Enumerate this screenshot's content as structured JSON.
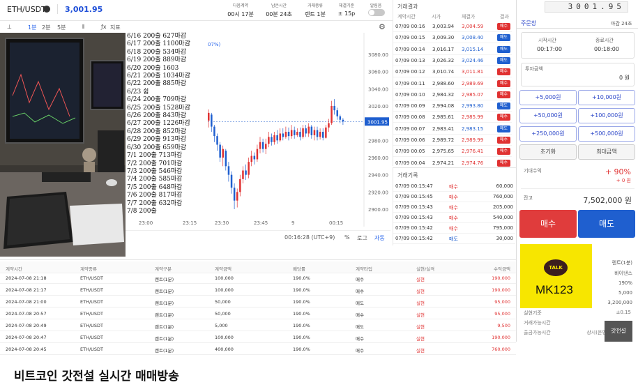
{
  "header": {
    "pair": "ETH/USDT",
    "price": "3,001.95",
    "cols": [
      {
        "label": "다음계약",
        "value": "00시 17분"
      },
      {
        "label": "남은시간",
        "value": "00분 24초"
      },
      {
        "label": "거래종류",
        "value": "렌트 1분"
      },
      {
        "label": "체결기준",
        "value": "± 15p"
      },
      {
        "label": "알림음",
        "value": ""
      }
    ]
  },
  "toolbar": {
    "items": [
      "1분",
      "2분",
      "5분",
      "지표"
    ]
  },
  "chart_data": {
    "type": "candlestick",
    "y_ticks": [
      "3080.00",
      "3060.00",
      "3040.00",
      "3020.00",
      "3001.95",
      "2980.00",
      "2960.00",
      "2940.00",
      "2920.00",
      "2900.00"
    ],
    "x_ticks": [
      "23:00",
      "23:15",
      "23:30",
      "23:45",
      "9",
      "00:15"
    ],
    "current_price": "3001.95",
    "pct_label": "07%)"
  },
  "chart_footer": {
    "time": "00:16:28 (UTC+9)",
    "pct": "%",
    "log": "로그",
    "auto": "자동"
  },
  "notes": [
    "6/16 200출 627마감",
    "6/17 200출 1100마감",
    "6/18 200출 534마감",
    "6/19 200출 889마감",
    "6/20 200출 1603",
    "6/21 200출 1034마감",
    "6/22 200출 885마감",
    "6/23 쉼",
    "6/24 200출 709마감",
    "6/25 200출 1528마감",
    "6/26 200출 843마감",
    "6/27 200출 1226마감",
    "6/28 200출 852마감",
    "6/29 200출 913마감",
    "6/30 200출 659마감",
    "7/1  200출 713마감",
    "7/2  200출 701마감",
    "7/3  200출 546마감",
    "7/4  200출 585마감",
    "7/5  200출 648마감",
    "7/6  200출 817마감",
    "7/7  200출 632마감",
    "7/8  200출"
  ],
  "orderbook": {
    "title": "거래결과",
    "headers": [
      "계약시간",
      "시가",
      "체결가",
      "결과"
    ],
    "rows": [
      {
        "time": "07/09 00:16",
        "open": "3,003.94",
        "close": "3,004.59",
        "result": "매수",
        "color": "red"
      },
      {
        "time": "07/09 00:15",
        "open": "3,009.30",
        "close": "3,008.40",
        "result": "매도",
        "color": "blue"
      },
      {
        "time": "07/09 00:14",
        "open": "3,016.17",
        "close": "3,015.14",
        "result": "매도",
        "color": "blue"
      },
      {
        "time": "07/09 00:13",
        "open": "3,026.32",
        "close": "3,024.46",
        "result": "매도",
        "color": "blue"
      },
      {
        "time": "07/09 00:12",
        "open": "3,010.74",
        "close": "3,011.81",
        "result": "매수",
        "color": "red"
      },
      {
        "time": "07/09 00:11",
        "open": "2,988.60",
        "close": "2,989.69",
        "result": "매수",
        "color": "red"
      },
      {
        "time": "07/09 00:10",
        "open": "2,984.32",
        "close": "2,985.07",
        "result": "매수",
        "color": "red"
      },
      {
        "time": "07/09 00:09",
        "open": "2,994.08",
        "close": "2,993.80",
        "result": "매도",
        "color": "blue"
      },
      {
        "time": "07/09 00:08",
        "open": "2,985.61",
        "close": "2,985.99",
        "result": "매수",
        "color": "red"
      },
      {
        "time": "07/09 00:07",
        "open": "2,983.41",
        "close": "2,983.15",
        "result": "매도",
        "color": "blue"
      },
      {
        "time": "07/09 00:06",
        "open": "2,989.72",
        "close": "2,989.99",
        "result": "매수",
        "color": "red"
      },
      {
        "time": "07/09 00:05",
        "open": "2,975.65",
        "close": "2,976.41",
        "result": "매수",
        "color": "red"
      },
      {
        "time": "07/09 00:04",
        "open": "2,974.21",
        "close": "2,974.76",
        "result": "매수",
        "color": "red"
      }
    ]
  },
  "trades": {
    "title": "거래기록",
    "rows": [
      {
        "time": "07/09 00:15:47",
        "side": "매수",
        "amount": "60,000",
        "color": "red"
      },
      {
        "time": "07/09 00:15:45",
        "side": "매수",
        "amount": "760,000",
        "color": "red"
      },
      {
        "time": "07/09 00:15:43",
        "side": "매수",
        "amount": "205,000",
        "color": "red"
      },
      {
        "time": "07/09 00:15:43",
        "side": "매수",
        "amount": "540,000",
        "color": "red"
      },
      {
        "time": "07/09 00:15:42",
        "side": "매수",
        "amount": "795,000",
        "color": "red"
      },
      {
        "time": "07/09 00:15:42",
        "side": "매도",
        "amount": "30,000",
        "color": "blue"
      }
    ]
  },
  "right_panel": {
    "ticker": "3001.95",
    "tab": "주문창",
    "tab_right": "마감 24초",
    "start_label": "시작시간",
    "start_value": "00:17:00",
    "end_label": "종료시간",
    "end_value": "00:18:00",
    "invest_label": "투자금액",
    "invest_value": "0 원",
    "amount_buttons": [
      "+5,000원",
      "+10,000원",
      "+50,000원",
      "+100,000원",
      "+250,000원",
      "+500,000원"
    ],
    "reset": "초기화",
    "max": "최대금액",
    "expected_label": "기대수익",
    "expected_pct": "+ 90%",
    "expected_value": "+ 0 원",
    "balance_label": "잔고",
    "balance_value": "7,502,000 원",
    "buy": "매수",
    "sell": "매도",
    "talk_badge": "TALK",
    "talk_id": "MK123",
    "info_right": [
      "렌트(1분)",
      "바이낸스",
      "190%",
      "5,000",
      "3,200,000"
    ],
    "info_left": [
      "실현기준",
      "거래가능시간",
      "출금가능시간"
    ],
    "info_left_vals": [
      "±0.15",
      "",
      "상시(운영중)"
    ],
    "corner": "갓전설"
  },
  "history": {
    "headers": [
      "계약시간",
      "계약종류",
      "계약구분",
      "계약금액",
      "배당률",
      "계약타입",
      "실현/실격",
      "수익금액"
    ],
    "rows": [
      [
        "2024-07-08 21:18",
        "ETH/USDT",
        "렌트(1분)",
        "100,000",
        "190.0%",
        "매수",
        "실현",
        "190,000"
      ],
      [
        "2024-07-08 21:17",
        "ETH/USDT",
        "렌트(1분)",
        "100,000",
        "190.0%",
        "매수",
        "실현",
        "190,000"
      ],
      [
        "2024-07-08 21:00",
        "ETH/USDT",
        "렌트(1분)",
        "50,000",
        "190.0%",
        "매도",
        "실현",
        "95,000"
      ],
      [
        "2024-07-08 20:57",
        "ETH/USDT",
        "렌트(1분)",
        "50,000",
        "190.0%",
        "매수",
        "실현",
        "95,000"
      ],
      [
        "2024-07-08 20:49",
        "ETH/USDT",
        "렌트(1분)",
        "5,000",
        "190.0%",
        "매도",
        "실현",
        "9,500"
      ],
      [
        "2024-07-08 20:47",
        "ETH/USDT",
        "렌트(1분)",
        "100,000",
        "190.0%",
        "매수",
        "실현",
        "190,000"
      ],
      [
        "2024-07-08 20:45",
        "ETH/USDT",
        "렌트(1분)",
        "400,000",
        "190.0%",
        "매수",
        "실현",
        "760,000"
      ]
    ]
  },
  "caption": "비트코인 갓전설 실시간 매매방송"
}
